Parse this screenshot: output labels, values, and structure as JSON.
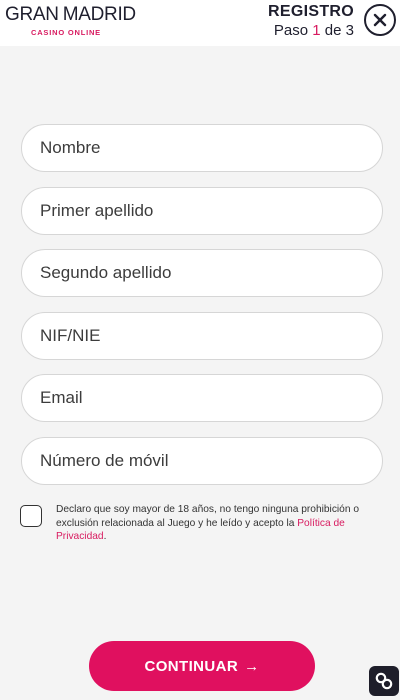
{
  "header": {
    "logo": {
      "left": "GRAN",
      "right": "MADRID",
      "sub": "CASINO ONLINE"
    },
    "title": "REGISTRO",
    "step": {
      "prefix": "Paso",
      "current": "1",
      "separator": "de",
      "total": "3"
    },
    "close_icon": "close-icon"
  },
  "form": {
    "fields": [
      {
        "placeholder": "Nombre"
      },
      {
        "placeholder": "Primer apellido"
      },
      {
        "placeholder": "Segundo apellido"
      },
      {
        "placeholder": "NIF/NIE"
      },
      {
        "placeholder": "Email"
      },
      {
        "placeholder": "Número de móvil"
      }
    ],
    "consent": {
      "text": "Declaro que soy mayor de 18 años, no tengo ninguna prohibición o exclusión relacionada al Juego y he leído y acepto la ",
      "link": "Política de Privacidad",
      "end": "."
    },
    "submit": {
      "label": "CONTINUAR",
      "arrow": "→"
    }
  },
  "widget": {
    "icon": "link-icon"
  },
  "colors": {
    "accent": "#e0105f",
    "accent_text": "#d81b60",
    "dark": "#1f1f2e",
    "background": "#f4f4f4"
  }
}
